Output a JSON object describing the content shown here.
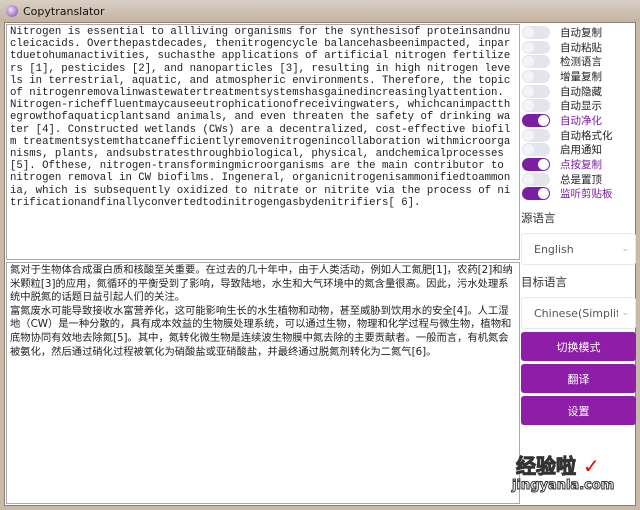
{
  "window": {
    "title": "Copytranslator"
  },
  "source_text": "Nitrogen is essential to allliving organisms for the synthesisof proteinsandnucleicacids. Overthepastdecades, thenitrogencycle balancehasbeenimpacted, inpartduetohumanactivities, suchasthe applications of artificial nitrogen fertilizers [1], pesticides [2], and nanoparticles [3], resulting in high nitrogen levels in terrestrial, aquatic, and atmospheric environments. Therefore, the topic of nitrogenremovalinwastewatertreatmentsystemshasgainedincreasinglyattention. Nitrogen-richeffluentmaycauseeutrophicationofreceivingwaters, whichcanimpactthegrowthofaquaticplantsand animals, and even threaten the safety of drinking water [4]. Constructed wetlands (CWs) are a decentralized, cost-effective biofilm treatmentsystemthatcanefficientlyremovenitrogenincollaboration withmicroorganisms, plants, andsubstratesthroughbiological, physical, andchemicalprocesses[5]. Ofthese, nitrogen-transformingmicroorganisms are the main contributor to nitrogen removal in CW biofilms. Ingeneral, organicnitrogenisammonifiedtoammonia, which is subsequently oxidized to nitrate or nitrite via the process of nitrificationandfinallyconvertedtodinitrogengasbydenitrifiers[ 6].",
  "translated_text": "氮对于生物体合成蛋白质和核酸至关重要。在过去的几十年中，由于人类活动，例如人工氮肥[1]，农药[2]和纳米颗粒[3]的应用，氮循环的平衡受到了影响，导致陆地，水生和大气环境中的氮含量很高。因此，污水处理系统中脱氮的话题日益引起人们的关注。\n富氮废水可能导致接收水富营养化，这可能影响生长的水生植物和动物，甚至威胁到饮用水的安全[4]。人工湿地（CW）是一种分散的，具有成本效益的生物膜处理系统，可以通过生物，物理和化学过程与微生物，植物和底物协同有效地去除氮[5]。其中，氮转化微生物是连续波生物膜中氮去除的主要贡献者。一般而言，有机氮会被氨化，然后通过硝化过程被氧化为硝酸盐或亚硝酸盐，并最终通过脱氮剂转化为二氮气[6]。",
  "toggles": [
    {
      "label": "自动复制",
      "on": false
    },
    {
      "label": "自动粘贴",
      "on": false
    },
    {
      "label": "检测语言",
      "on": false
    },
    {
      "label": "增量复制",
      "on": false
    },
    {
      "label": "自动隐藏",
      "on": false
    },
    {
      "label": "自动显示",
      "on": false
    },
    {
      "label": "自动净化",
      "on": true
    },
    {
      "label": "自动格式化",
      "on": false
    },
    {
      "label": "启用通知",
      "on": false
    },
    {
      "label": "点按复制",
      "on": true
    },
    {
      "label": "总是置顶",
      "on": false
    },
    {
      "label": "监听剪贴板",
      "on": true
    }
  ],
  "source_language": {
    "label": "源语言",
    "value": "English"
  },
  "target_language": {
    "label": "目标语言",
    "value": "Chinese(Simplified)"
  },
  "buttons": {
    "switch_mode": "切换模式",
    "translate": "翻译",
    "settings": "设置"
  },
  "watermark": {
    "line1": "经验啦",
    "line2": "jingyanla.com"
  },
  "colors": {
    "accent": "#8e1ea8"
  }
}
